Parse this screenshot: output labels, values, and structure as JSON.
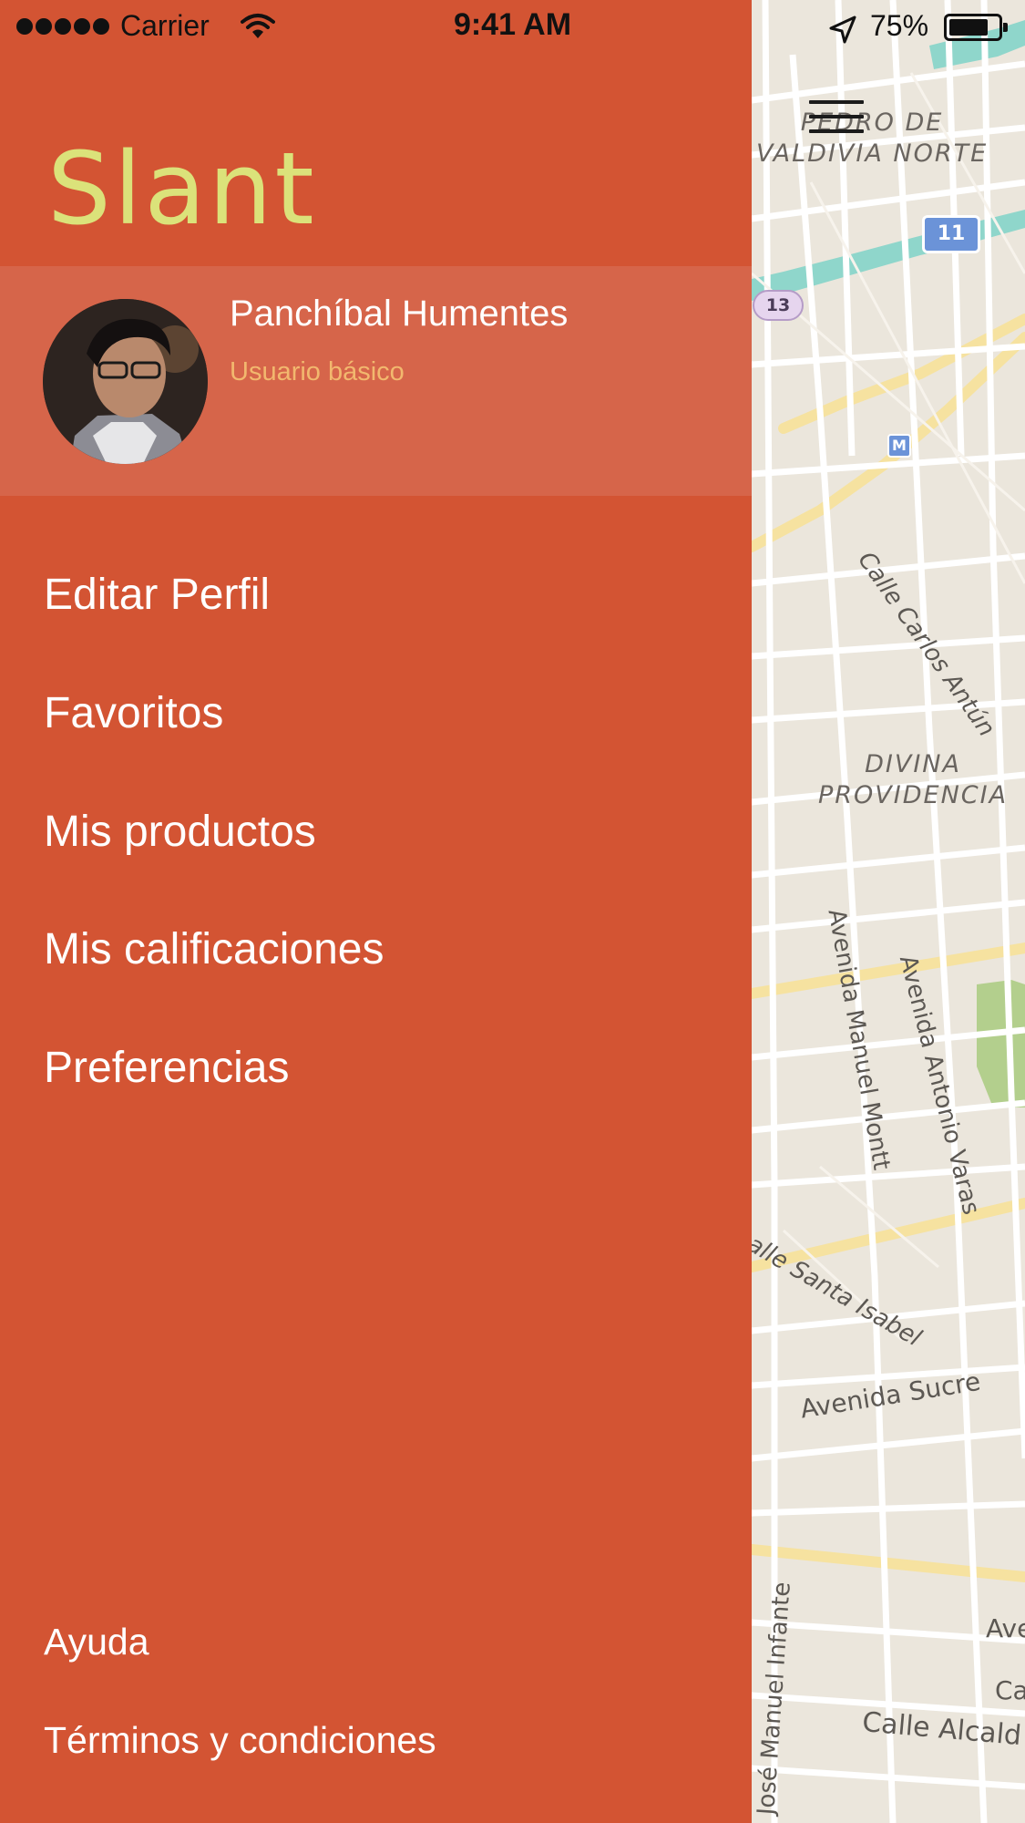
{
  "status_bar": {
    "carrier": "Carrier",
    "time": "9:41 AM",
    "battery": "75%"
  },
  "map": {
    "area_labels": [
      "PEDRO DE",
      "VALDIVIA NORTE",
      "DIVINA",
      "PROVIDENCIA"
    ],
    "street_labels": [
      "Calle Carlos Antún",
      "Avenida Manuel Montt",
      "Avenida Antonio Varas",
      "alle Santa Isabel",
      "Avenida Sucre",
      "José Manuel Infante",
      "Ave",
      "Ca",
      "Calle Alcald"
    ],
    "route_shields": [
      "11",
      "13",
      "M"
    ]
  },
  "drawer": {
    "brand": "Slant",
    "profile": {
      "name": "Panchíbal Humentes",
      "role": "Usuario básico"
    },
    "menu": [
      "Editar Perfil",
      "Favoritos",
      "Mis productos",
      "Mis calificaciones",
      "Preferencias"
    ],
    "footer": [
      "Ayuda",
      "Términos y condiciones"
    ]
  },
  "colors": {
    "drawer_bg": "#d35433",
    "profile_bg": "#d6654a",
    "brand": "#dbe27a",
    "role_text": "#f2b86e",
    "map_bg": "#ebe6dc"
  },
  "icons": [
    "signal-dots-icon",
    "wifi-icon",
    "location-arrow-icon",
    "battery-icon",
    "hamburger-menu-icon"
  ]
}
